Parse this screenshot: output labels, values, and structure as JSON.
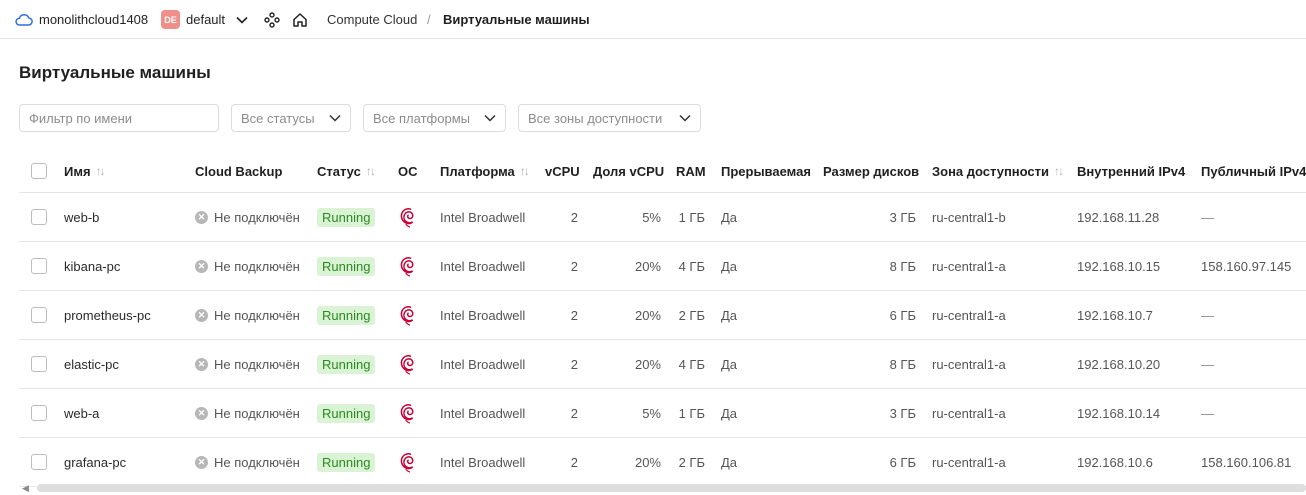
{
  "header": {
    "cloud_name": "monolithcloud1408",
    "folder_badge": "DE",
    "folder_name": "default",
    "breadcrumb_service": "Compute Cloud",
    "breadcrumb_separator": "/",
    "breadcrumb_current": "Виртуальные машины"
  },
  "page_title": "Виртуальные машины",
  "filters": {
    "name_placeholder": "Фильтр по имени",
    "status": "Все статусы",
    "platform": "Все платформы",
    "zone": "Все зоны доступности"
  },
  "table": {
    "columns": {
      "name": "Имя",
      "backup": "Cloud Backup",
      "status": "Статус",
      "os": "ОС",
      "platform": "Платформа",
      "vcpu": "vCPU",
      "share": "Доля vCPU",
      "ram": "RAM",
      "preemptible": "Прерываемая",
      "disk": "Размер дисков",
      "zone": "Зона доступности",
      "ip_internal": "Внутренний IPv4",
      "ip_public": "Публичный IPv4"
    },
    "sort_glyph": "↑↓",
    "rows": [
      {
        "name": "web-b",
        "backup": "Не подключён",
        "status": "Running",
        "os_icon": "debian-icon",
        "platform": "Intel Broadwell",
        "vcpu": "2",
        "share": "5%",
        "ram": "1 ГБ",
        "preemptible": "Да",
        "disk": "3 ГБ",
        "zone": "ru-central1-b",
        "ip_internal": "192.168.11.28",
        "ip_public": "—"
      },
      {
        "name": "kibana-pc",
        "backup": "Не подключён",
        "status": "Running",
        "os_icon": "debian-icon",
        "platform": "Intel Broadwell",
        "vcpu": "2",
        "share": "20%",
        "ram": "4 ГБ",
        "preemptible": "Да",
        "disk": "8 ГБ",
        "zone": "ru-central1-a",
        "ip_internal": "192.168.10.15",
        "ip_public": "158.160.97.145"
      },
      {
        "name": "prometheus-pc",
        "backup": "Не подключён",
        "status": "Running",
        "os_icon": "debian-icon",
        "platform": "Intel Broadwell",
        "vcpu": "2",
        "share": "20%",
        "ram": "2 ГБ",
        "preemptible": "Да",
        "disk": "6 ГБ",
        "zone": "ru-central1-a",
        "ip_internal": "192.168.10.7",
        "ip_public": "—"
      },
      {
        "name": "elastic-pc",
        "backup": "Не подключён",
        "status": "Running",
        "os_icon": "debian-icon",
        "platform": "Intel Broadwell",
        "vcpu": "2",
        "share": "20%",
        "ram": "4 ГБ",
        "preemptible": "Да",
        "disk": "8 ГБ",
        "zone": "ru-central1-a",
        "ip_internal": "192.168.10.20",
        "ip_public": "—"
      },
      {
        "name": "web-a",
        "backup": "Не подключён",
        "status": "Running",
        "os_icon": "debian-icon",
        "platform": "Intel Broadwell",
        "vcpu": "2",
        "share": "5%",
        "ram": "1 ГБ",
        "preemptible": "Да",
        "disk": "3 ГБ",
        "zone": "ru-central1-a",
        "ip_internal": "192.168.10.14",
        "ip_public": "—"
      },
      {
        "name": "grafana-pc",
        "backup": "Не подключён",
        "status": "Running",
        "os_icon": "debian-icon",
        "platform": "Intel Broadwell",
        "vcpu": "2",
        "share": "20%",
        "ram": "2 ГБ",
        "preemptible": "Да",
        "disk": "6 ГБ",
        "zone": "ru-central1-a",
        "ip_internal": "192.168.10.6",
        "ip_public": "158.160.106.81"
      }
    ]
  },
  "colors": {
    "accent": "#2f6fe0",
    "status_running_bg": "#d9f3d4",
    "status_running_fg": "#2d8a22",
    "folder_badge_bg": "#f08e8a",
    "debian_red": "#c70036"
  }
}
